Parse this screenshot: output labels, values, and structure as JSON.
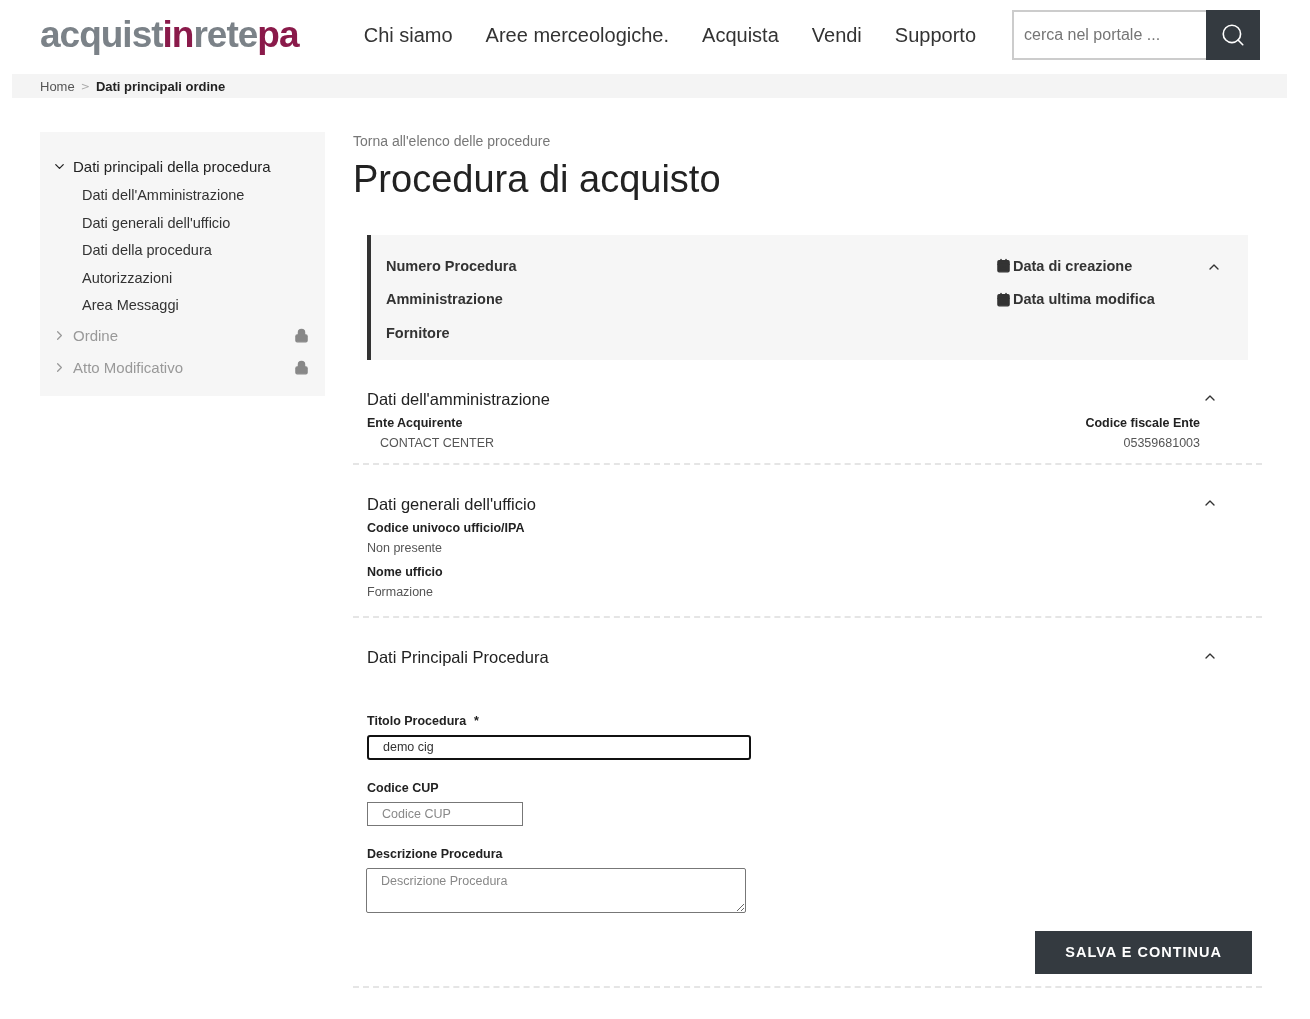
{
  "header": {
    "logo": [
      {
        "text": "acquist",
        "accent": false
      },
      {
        "text": "in",
        "accent": true
      },
      {
        "text": "rete",
        "accent": false
      },
      {
        "text": "pa",
        "accent": true
      }
    ],
    "nav": [
      "Chi siamo",
      "Aree merceologiche.",
      "Acquista",
      "Vendi",
      "Supporto"
    ],
    "search": {
      "placeholder": "cerca nel portale ..."
    }
  },
  "breadcrumb_separator": ">",
  "breadcrumb": [
    {
      "label": "Home",
      "current": false
    },
    {
      "label": "Dati principali ordine",
      "current": true
    }
  ],
  "sidebar": {
    "items": [
      {
        "label": "Dati principali della procedura",
        "expanded": true,
        "locked": false,
        "children": [
          {
            "label": "Dati dell'Amministrazione"
          },
          {
            "label": "Dati generali dell'ufficio"
          },
          {
            "label": "Dati della procedura"
          },
          {
            "label": "Autorizzazioni"
          },
          {
            "label": "Area Messaggi"
          }
        ]
      },
      {
        "label": "Ordine",
        "expanded": false,
        "locked": true
      },
      {
        "label": "Atto Modificativo",
        "expanded": false,
        "locked": true
      }
    ]
  },
  "back_link": "Torna all'elenco delle procedure",
  "title": "Procedura di acquisto",
  "summary": {
    "expanded": true,
    "left": [
      "Numero Procedura",
      "Amministrazione",
      "Fornitore"
    ],
    "right": [
      "Data di creazione",
      "Data ultima modifica"
    ]
  },
  "sections": [
    {
      "kind": "pairs",
      "title": "Dati dell'amministrazione",
      "expanded": true,
      "left": {
        "label": "Ente Acquirente",
        "value": "CONTACT CENTER"
      },
      "right": {
        "label": "Codice fiscale Ente",
        "value": "05359681003"
      }
    },
    {
      "kind": "list",
      "title": "Dati generali dell'ufficio",
      "expanded": true,
      "fields": [
        {
          "label": "Codice univoco ufficio/IPA",
          "value": "Non presente"
        },
        {
          "label": "Nome ufficio",
          "value": "Formazione"
        }
      ]
    },
    {
      "kind": "form",
      "title": "Dati Principali Procedura",
      "expanded": true,
      "inputs": [
        {
          "kind": "text",
          "label": "Titolo Procedura",
          "required_mark": "*",
          "value": "demo cig",
          "focused": true
        },
        {
          "kind": "short",
          "label": "Codice CUP",
          "placeholder": "Codice CUP",
          "focused": false
        },
        {
          "kind": "textarea",
          "label": "Descrizione Procedura",
          "placeholder": "Descrizione Procedura",
          "focused": false
        }
      ],
      "button": "SALVA E CONTINUA"
    }
  ]
}
